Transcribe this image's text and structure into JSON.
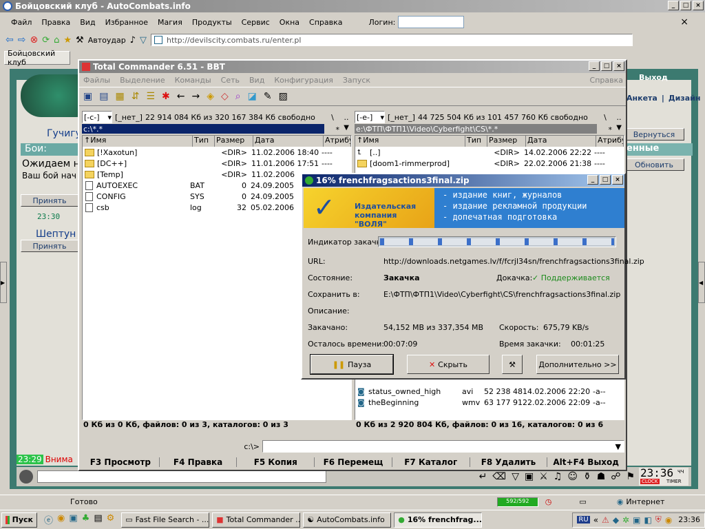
{
  "browser": {
    "title": "Бойцовский клуб - AutoCombats.info",
    "menu": [
      "Файл",
      "Правка",
      "Вид",
      "Избранное",
      "Магия",
      "Продукты",
      "Сервис",
      "Окна",
      "Справка"
    ],
    "login_label": "Логин:",
    "autoudar": "Автоудар",
    "address": "http://devilscity.combats.ru/enter.pl",
    "tab": "Бойцовский клуб",
    "status": "Готово",
    "zone": "Интернет",
    "progress": "592/592"
  },
  "game": {
    "exit": "Выход",
    "links": [
      "Анкета",
      "Дизайн"
    ],
    "hero": "Гучигу",
    "battles": "Бои:",
    "wait": "Ожидаем н",
    "your_fight": "Ваш бой нач",
    "accept": "Принять",
    "time1": "23:30",
    "shepot": "Шептун",
    "accept2": "Принять",
    "back": "Вернуться",
    "fresh": "енные",
    "refresh": "Обновить",
    "chat_time": "23:29",
    "chat_text": "Внима",
    "clock": "23:36",
    "clock_suffix": "ЧЧ",
    "clock_label": "CLOCK",
    "timer_label": "TIMER"
  },
  "tc": {
    "title": "Total Commander 6.51 - BBT",
    "menu": [
      "Файлы",
      "Выделение",
      "Команды",
      "Сеть",
      "Вид",
      "Конфигурация",
      "Запуск"
    ],
    "help": "Справка",
    "left": {
      "drive": "[-c-]",
      "label": "[_нет_]",
      "free": "22 914 084 Кб из 320 167 384 Кб свободно",
      "path": "c:\\*.*",
      "cols": [
        "↑Имя",
        "Тип",
        "Размер",
        "Дата",
        "Атрибу"
      ],
      "rows": [
        {
          "name": "[!Xaxotun]",
          "type": "",
          "size": "<DIR>",
          "date": "11.02.2006 18:40",
          "attr": "----",
          "kind": "folder"
        },
        {
          "name": "[DC++]",
          "type": "",
          "size": "<DIR>",
          "date": "11.01.2006 17:51",
          "attr": "----",
          "kind": "folder"
        },
        {
          "name": "[Temp]",
          "type": "",
          "size": "<DIR>",
          "date": "11.02.2006",
          "attr": "",
          "kind": "folder"
        },
        {
          "name": "AUTOEXEC",
          "type": "BAT",
          "size": "0",
          "date": "24.09.2005",
          "attr": "",
          "kind": "file"
        },
        {
          "name": "CONFIG",
          "type": "SYS",
          "size": "0",
          "date": "24.09.2005",
          "attr": "",
          "kind": "file"
        },
        {
          "name": "csb",
          "type": "log",
          "size": "32",
          "date": "05.02.2006",
          "attr": "",
          "kind": "file"
        }
      ],
      "status": "0 Кб из 0 Кб, файлов: 0 из 3, каталогов: 0 из 3"
    },
    "right": {
      "drive": "[-e-]",
      "label": "[_нет_]",
      "free": "44 725 504 Кб из 101 457 760 Кб свободно",
      "path": "e:\\ФТП\\ФТП1\\Video\\Cyberfight\\CS\\*.*",
      "cols": [
        "↑Имя",
        "Тип",
        "Размер",
        "Дата",
        "Атрибу"
      ],
      "rows": [
        {
          "name": "[..]",
          "type": "",
          "size": "<DIR>",
          "date": "14.02.2006 22:22",
          "attr": "----",
          "kind": "up"
        },
        {
          "name": "[doom1-rimmerprod]",
          "type": "",
          "size": "<DIR>",
          "date": "22.02.2006 21:38",
          "attr": "----",
          "kind": "folder"
        }
      ],
      "rows_bottom": [
        {
          "name": "status_owned_high",
          "type": "avi",
          "size": "52 238 484",
          "date": "14.02.2006 22:20",
          "attr": "-a--"
        },
        {
          "name": "theBeginning",
          "type": "wmv",
          "size": "63 177 910",
          "date": "22.02.2006 22:09",
          "attr": "-a--"
        }
      ],
      "status": "0 Кб из 2 920 804 Кб, файлов: 0 из 16, каталогов: 0 из 6"
    },
    "cmd_path": "c:\\>",
    "fkeys": [
      "F3 Просмотр",
      "F4 Правка",
      "F5 Копия",
      "F6 Перемещ",
      "F7 Каталог",
      "F8 Удалить",
      "Alt+F4 Выход"
    ]
  },
  "dl": {
    "title": "16% frenchfragsactions3final.zip",
    "banner_left": "Издательская компания \"ВОЛЯ\"",
    "banner_lines": [
      "- издание книг, журналов",
      "- издание рекламной продукции",
      "- допечатная подготовка"
    ],
    "progress_label": "Индикатор закачки:",
    "progress": 0.16,
    "url_label": "URL:",
    "url": "http://downloads.netgames.lv/f/fcrjl34sn/frenchfragsactions3final.zip",
    "state_label": "Состояние:",
    "state": "Закачка",
    "resume_label": "Докачка:",
    "resume": "Поддерживается",
    "save_label": "Сохранить в:",
    "save": "E:\\ФТП\\ФТП1\\Video\\Cyberfight\\CS\\frenchfragsactions3final.zip",
    "desc_label": "Описание:",
    "done_label": "Закачано:",
    "done": "54,152 MB из 337,354 MB",
    "speed_label": "Скорость:",
    "speed": "675,79 KB/s",
    "left_label": "Осталось времени:",
    "left": "00:07:09",
    "time_label": "Время закачки:",
    "time": "00:01:25",
    "pause": "Пауза",
    "hide": "Скрыть",
    "more": "Дополнительно >>"
  },
  "taskbar": {
    "start": "Пуск",
    "tasks": [
      "Fast File Search - ...",
      "Total Commander ...",
      "AutoCombats.info",
      "16% frenchfrag..."
    ],
    "lang": "RU",
    "time": "23:36"
  },
  "colors": {
    "title_active": "#0a246a",
    "title_grad": "#a6caf0",
    "title_inactive": "#808080",
    "game_teal": "#2e6e68",
    "game_green": "#3fa13a"
  }
}
